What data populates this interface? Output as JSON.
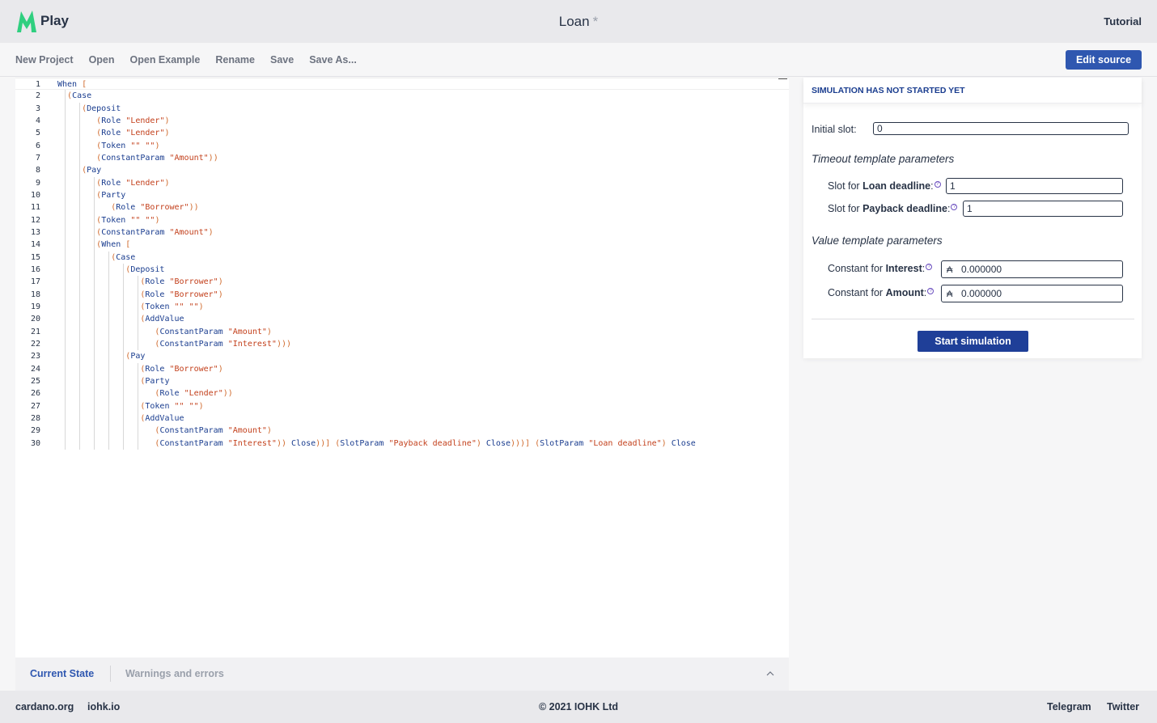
{
  "header": {
    "logo_text": "Play",
    "title": "Loan",
    "modified_marker": "*",
    "tutorial": "Tutorial"
  },
  "menu": {
    "items": [
      "New Project",
      "Open",
      "Open Example",
      "Rename",
      "Save",
      "Save As..."
    ],
    "edit_source": "Edit source"
  },
  "editor": {
    "line_numbers": [
      "1",
      "2",
      "3",
      "4",
      "5",
      "6",
      "7",
      "8",
      "9",
      "10",
      "11",
      "12",
      "13",
      "14",
      "15",
      "16",
      "17",
      "18",
      "19",
      "20",
      "21",
      "22",
      "23",
      "24",
      "25",
      "26",
      "27",
      "28",
      "29",
      "30"
    ],
    "lines": [
      "When [",
      "  (Case",
      "     (Deposit",
      "        (Role \"Lender\")",
      "        (Role \"Lender\")",
      "        (Token \"\" \"\")",
      "        (ConstantParam \"Amount\"))",
      "     (Pay",
      "        (Role \"Lender\")",
      "        (Party",
      "           (Role \"Borrower\"))",
      "        (Token \"\" \"\")",
      "        (ConstantParam \"Amount\")",
      "        (When [",
      "           (Case",
      "              (Deposit",
      "                 (Role \"Borrower\")",
      "                 (Role \"Borrower\")",
      "                 (Token \"\" \"\")",
      "                 (AddValue",
      "                    (ConstantParam \"Amount\")",
      "                    (ConstantParam \"Interest\")))",
      "              (Pay",
      "                 (Role \"Borrower\")",
      "                 (Party",
      "                    (Role \"Lender\"))",
      "                 (Token \"\" \"\")",
      "                 (AddValue",
      "                    (ConstantParam \"Amount\")",
      "                    (ConstantParam \"Interest\")) Close))] (SlotParam \"Payback deadline\") Close)))] (SlotParam \"Loan deadline\") Close"
    ]
  },
  "bottom_tabs": {
    "current_state": "Current State",
    "warnings": "Warnings and errors"
  },
  "simulation": {
    "status": "SIMULATION HAS NOT STARTED YET",
    "initial_slot_label": "Initial slot:",
    "initial_slot_value": "0",
    "timeout_title": "Timeout template parameters",
    "loan_deadline_prefix": "Slot for ",
    "loan_deadline_name": "Loan deadline",
    "loan_deadline_value": "1",
    "payback_deadline_prefix": "Slot for ",
    "payback_deadline_name": "Payback deadline",
    "payback_deadline_value": "1",
    "value_title": "Value template parameters",
    "interest_prefix": "Constant for ",
    "interest_name": "Interest",
    "interest_value": "0.000000",
    "amount_prefix": "Constant for ",
    "amount_name": "Amount",
    "amount_value": "0.000000",
    "currency_symbol": "₳",
    "colon": ":",
    "help_glyph": "?",
    "start_button": "Start simulation"
  },
  "footer": {
    "cardano": "cardano.org",
    "iohk": "iohk.io",
    "copyright": "© 2021 IOHK Ltd",
    "telegram": "Telegram",
    "twitter": "Twitter"
  },
  "colors": {
    "accent": "#2f57b0",
    "primary_button": "#1f3f98",
    "logo": "#2fcf7f",
    "string": "#c3401c",
    "keyword": "#1a3d8f"
  }
}
